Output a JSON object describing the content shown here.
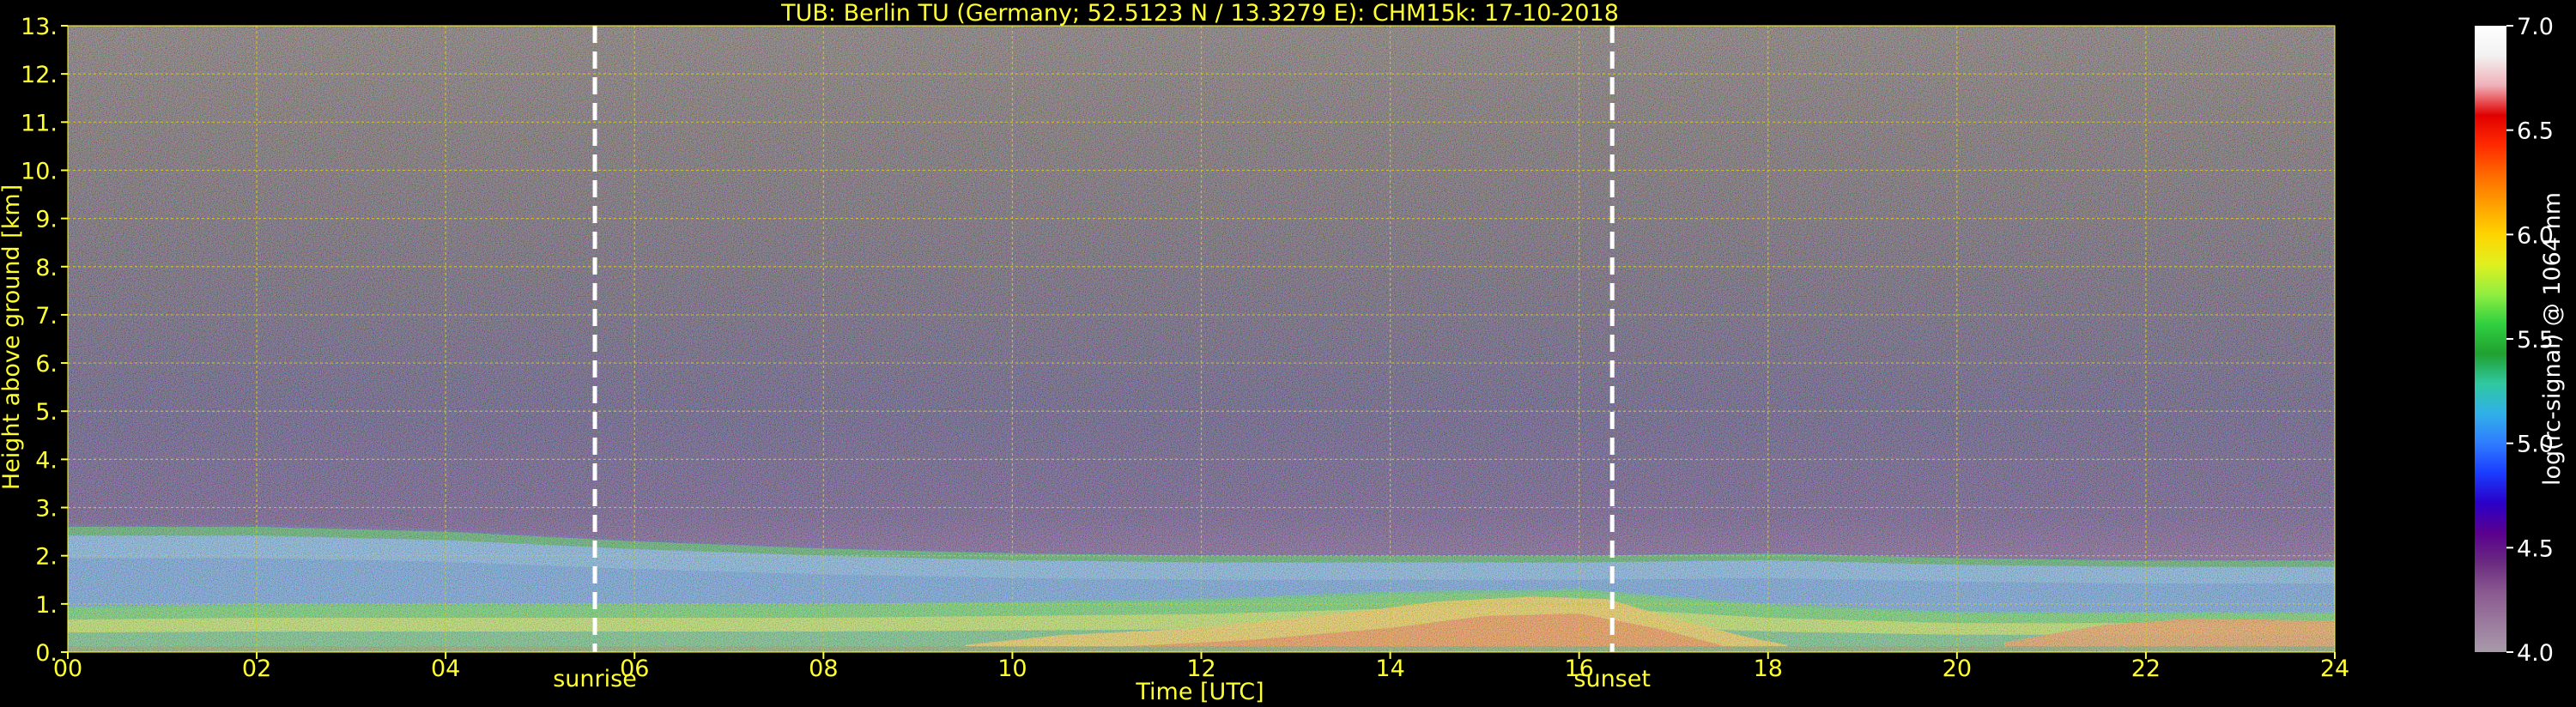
{
  "colors": {
    "background": "#000000",
    "text": "#ffff33",
    "grid": "#d8c800",
    "marker": "#ffffff",
    "cbar_text": "#ffffff",
    "cbar_stops": [
      "#a89aaa",
      "#9a7a9e",
      "#8a5a90",
      "#6a2a80",
      "#5a008f",
      "#2a00c8",
      "#1a3cff",
      "#2f7cff",
      "#30b0e8",
      "#30c8a0",
      "#20a030",
      "#30d040",
      "#90ee40",
      "#e0f020",
      "#ffd400",
      "#ffa000",
      "#ff6a00",
      "#ff2a00",
      "#e00000",
      "#f0b0b8",
      "#f2f2f2",
      "#ffffff"
    ]
  },
  "chart_data": {
    "type": "heatmap",
    "title": "TUB: Berlin TU (Germany; 52.5123 N / 13.3279 E):    CHM15k: 17-10-2018",
    "xlabel": "Time [UTC]",
    "ylabel": "Height above ground [km]",
    "xlim": [
      0,
      24
    ],
    "ylim": [
      0,
      13
    ],
    "x_ticks": [
      0,
      2,
      4,
      6,
      8,
      10,
      12,
      14,
      16,
      18,
      20,
      22,
      24
    ],
    "x_tick_labels": [
      "00",
      "02",
      "04",
      "06",
      "08",
      "10",
      "12",
      "14",
      "16",
      "18",
      "20",
      "22",
      "24"
    ],
    "y_ticks": [
      0,
      1,
      2,
      3,
      4,
      5,
      6,
      7,
      8,
      9,
      10,
      11,
      12,
      13
    ],
    "y_tick_labels": [
      "0.",
      "1.",
      "2.",
      "3.",
      "4.",
      "5.",
      "6.",
      "7.",
      "8.",
      "9.",
      "10.",
      "11.",
      "12.",
      "13."
    ],
    "grid": true,
    "markers": [
      {
        "label": "sunrise",
        "x": 5.58
      },
      {
        "label": "sunset",
        "x": 16.35
      }
    ],
    "colorbar": {
      "label": "log(rc-signal) @ 1064 nm",
      "range": [
        4.0,
        7.0
      ],
      "ticks": [
        4.0,
        4.5,
        5.0,
        5.5,
        6.0,
        6.5,
        7.0
      ],
      "tick_labels": [
        "4.0",
        "4.5",
        "5.0",
        "5.5",
        "6.0",
        "6.5",
        "7.0"
      ]
    },
    "layers": [
      {
        "name": "mixed layer top",
        "times": [
          0,
          2,
          4,
          6,
          8,
          10,
          12,
          14,
          16,
          18,
          20,
          22,
          24
        ],
        "heights_km": [
          2.6,
          2.6,
          2.5,
          2.3,
          2.15,
          2.05,
          2.0,
          2.0,
          2.0,
          2.05,
          1.95,
          1.9,
          1.9
        ]
      },
      {
        "name": "high-signal layer top",
        "times": [
          0,
          2,
          4,
          6,
          8,
          10,
          12,
          14,
          16,
          18,
          20,
          22,
          24
        ],
        "heights_km": [
          0.9,
          0.95,
          0.95,
          0.95,
          0.95,
          1.0,
          1.05,
          1.2,
          1.25,
          0.95,
          0.8,
          0.8,
          0.8
        ]
      }
    ]
  }
}
